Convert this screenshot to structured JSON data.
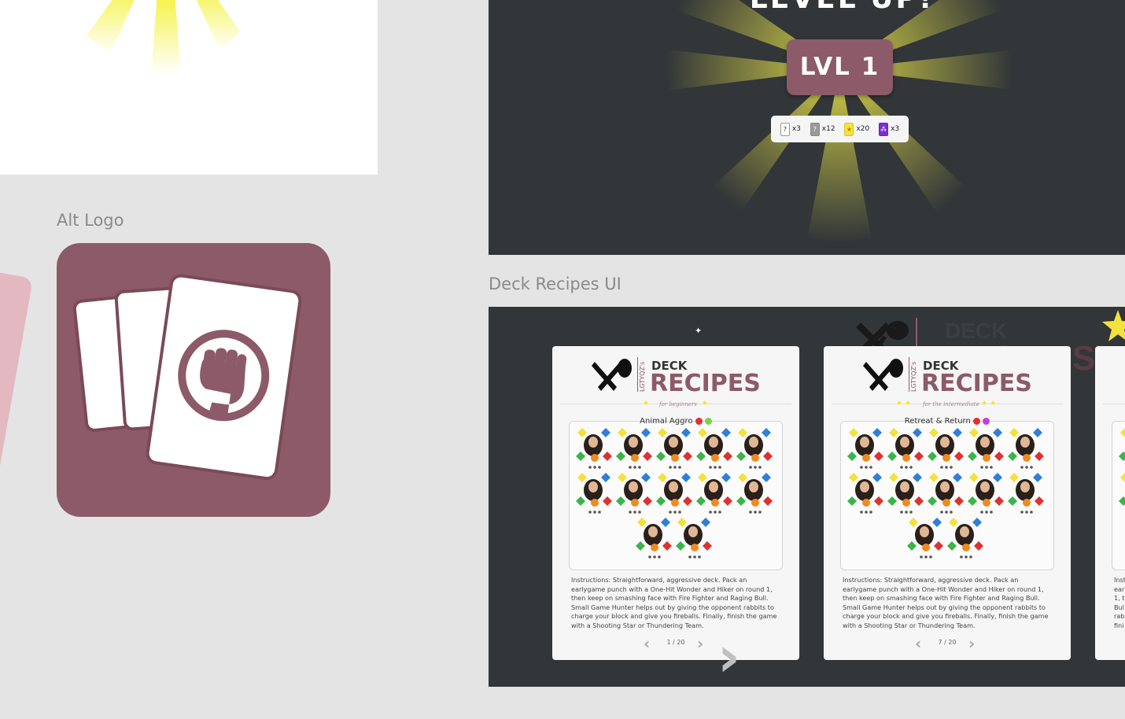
{
  "sections": {
    "alt_logo_label": "Alt Logo",
    "deck_recipes_label": "Deck Recipes UI"
  },
  "level_up": {
    "title": "LEVEL UP!",
    "badge": "LVL 1",
    "rewards": [
      {
        "icon": "?",
        "count": "x3"
      },
      {
        "icon": "?",
        "count": "x12"
      },
      {
        "icon": "★",
        "count": "x20"
      },
      {
        "icon": "⁂",
        "count": "x3"
      }
    ]
  },
  "deck_recipes": {
    "header_deck": "DECK",
    "header_recipes": "RECIPES",
    "header_brand": "LGTYQZ's",
    "cards": [
      {
        "subtitle": "for beginners",
        "deck_name": "Animal Aggro",
        "instructions": "Instructions: Straightforward, aggressive deck. Pack an earlygame punch with a One-Hit Wonder and Hiker on round 1, then keep on smashing face with Fire Fighter and Raging Bull. Small Game Hunter helps out by giving the opponent rabbits to charge your block and give you fireballs. Finally, finish the game with a Shooting Star or Thundering Team.",
        "pager": "1 / 20"
      },
      {
        "subtitle": "for the intermediate",
        "deck_name": "Retreat & Return",
        "instructions": "Instructions: Straightforward, aggressive deck. Pack an earlygame punch with a One-Hit Wonder and Hiker on round 1, then keep on smashing face with Fire Fighter and Raging Bull. Small Game Hunter helps out by giving the opponent rabbits to charge your block and give you fireballs. Finally, finish the game with a Shooting Star or Thundering Team.",
        "pager": "7 / 20"
      }
    ],
    "partial_card_prefix": [
      "Inst",
      "ear",
      "1, th",
      "Bul",
      "rab",
      "fini"
    ]
  },
  "colors": {
    "brand": "#8c5a69",
    "panel": "#323638",
    "canvas": "#e4e4e4",
    "ray": "#f4f23c"
  }
}
